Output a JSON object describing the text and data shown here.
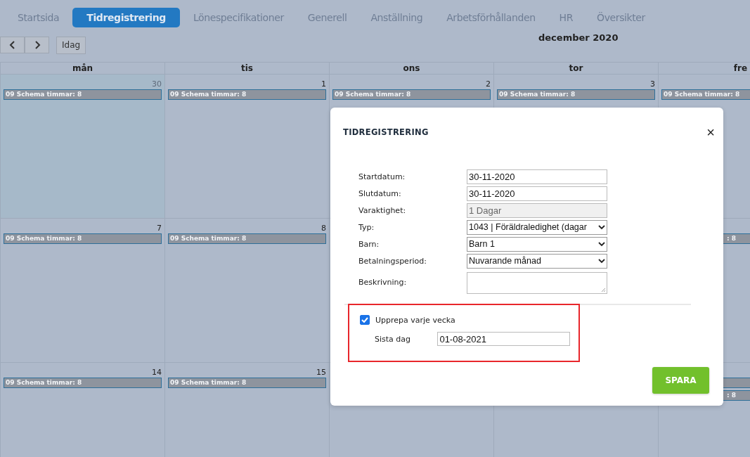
{
  "tabs": [
    {
      "label": "Startsida",
      "selected": false
    },
    {
      "label": "Tidregistrering",
      "selected": true
    },
    {
      "label": "Lönespecifikationer",
      "selected": false
    },
    {
      "label": "Generell",
      "selected": false
    },
    {
      "label": "Anställning",
      "selected": false
    },
    {
      "label": "Arbetsförhållanden",
      "selected": false
    },
    {
      "label": "HR",
      "selected": false
    },
    {
      "label": "Översikter",
      "selected": false
    }
  ],
  "toolbar": {
    "today_button": "Idag",
    "month_title": "december 2020"
  },
  "calendar": {
    "days": [
      "mån",
      "tis",
      "ons",
      "tor",
      "fre"
    ],
    "weeks": [
      {
        "cells": [
          {
            "date": "30",
            "other_month": true,
            "events": [
              {
                "kind": "text",
                "label": "09 Schema timmar: 8"
              }
            ]
          },
          {
            "date": "1",
            "other_month": false,
            "events": [
              {
                "kind": "text",
                "label": "09 Schema timmar: 8"
              }
            ]
          },
          {
            "date": "2",
            "other_month": false,
            "events": [
              {
                "kind": "text",
                "label": "09 Schema timmar: 8"
              }
            ]
          },
          {
            "date": "3",
            "other_month": false,
            "events": [
              {
                "kind": "text",
                "label": "09 Schema timmar: 8"
              }
            ]
          },
          {
            "events": [
              {
                "kind": "text",
                "label": "09 Schema timmar: 8"
              }
            ]
          }
        ]
      },
      {
        "cells": [
          {
            "date": "7",
            "other_month": false,
            "events": [
              {
                "kind": "text",
                "label": "09 Schema timmar: 8"
              }
            ]
          },
          {
            "date": "8",
            "other_month": false,
            "events": [
              {
                "kind": "text",
                "label": "09 Schema timmar: 8"
              }
            ]
          }
        ],
        "last_cell": {
          "covered": true,
          "events": [
            {
              "kind": "text",
              "label": ": 8"
            }
          ]
        }
      },
      {
        "cells": [
          {
            "date": "14",
            "other_month": false,
            "events": [
              {
                "kind": "text",
                "label": "09 Schema timmar: 8"
              }
            ]
          },
          {
            "date": "15",
            "other_month": false,
            "events": [
              {
                "kind": "text",
                "label": "09 Schema timmar: 8"
              }
            ]
          }
        ],
        "last_cell": {
          "covered": true,
          "events": [
            {
              "kind": "bar"
            },
            {
              "kind": "text",
              "label": ": 8"
            }
          ]
        }
      }
    ]
  },
  "dialog": {
    "title": "TIDREGISTRERING",
    "close": "×",
    "fields": [
      {
        "label": "Startdatum:",
        "kind": "text",
        "value": "30-11-2020"
      },
      {
        "label": "Slutdatum:",
        "kind": "text",
        "value": "30-11-2020"
      },
      {
        "label": "Varaktighet:",
        "kind": "readonly",
        "value": "1 Dagar"
      },
      {
        "label": "Typ:",
        "kind": "select",
        "value": "1043 | Föräldraledighet (dagar"
      },
      {
        "label": "Barn:",
        "kind": "select",
        "value": "Barn 1"
      },
      {
        "label": "Betalningsperiod:",
        "kind": "select",
        "value": "Nuvarande månad"
      },
      {
        "label": "Beskrivning:",
        "kind": "textarea"
      }
    ],
    "repeat": {
      "label": "Upprepa varje vecka",
      "checked": true,
      "highlighted": true,
      "last_day_label": "Sista dag",
      "last_day_value": "01-08-2021"
    },
    "save_button": "SPARA"
  }
}
